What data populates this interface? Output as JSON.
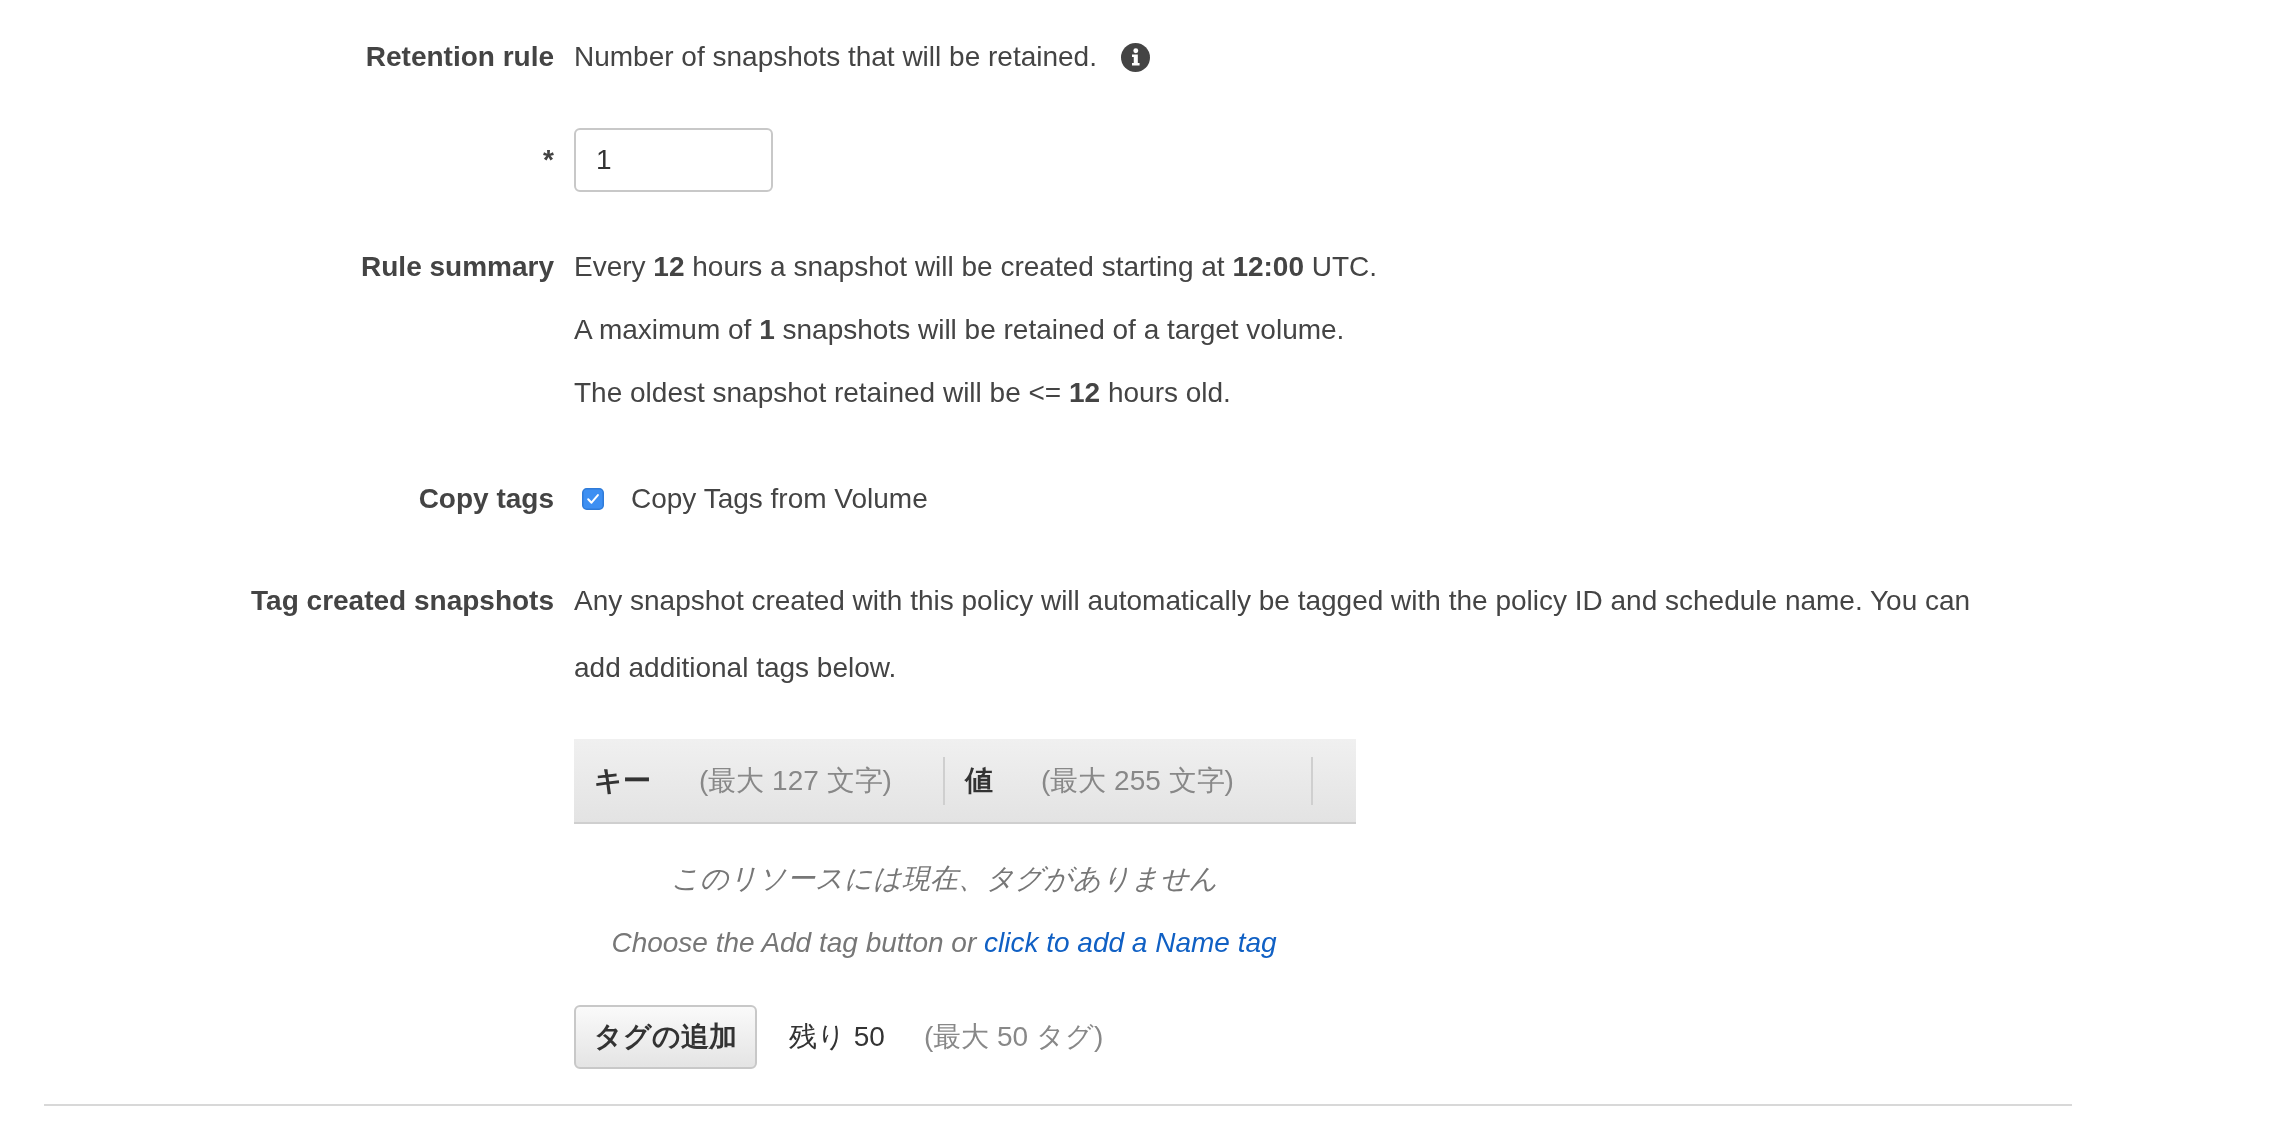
{
  "retention_rule": {
    "label": "Retention rule",
    "description": "Number of snapshots that will be retained.",
    "required_mark": "*",
    "value": "1"
  },
  "rule_summary": {
    "label": "Rule summary",
    "lines": [
      "Every **12** hours a snapshot will be created starting at **12:00** UTC.",
      "A maximum of **1** snapshots will be retained of a target volume.",
      "The oldest snapshot retained will be <= **12** hours old."
    ]
  },
  "copy_tags": {
    "label": "Copy tags",
    "option": "Copy Tags from Volume",
    "checked": true
  },
  "tag_created_snapshots": {
    "label": "Tag created snapshots",
    "description": "Any snapshot created with this policy will automatically be tagged with the policy ID and schedule name. You can add additional tags below."
  },
  "tag_table": {
    "columns": [
      {
        "name": "キー",
        "hint": "(最大 127 文字)"
      },
      {
        "name": "値",
        "hint": "(最大 255 文字)"
      }
    ],
    "empty_message": "このリソースには現在、タグがありません",
    "empty_hint": "Choose the Add tag button or",
    "empty_link": "click to add a Name tag"
  },
  "tag_footer": {
    "button": "タグの追加",
    "remaining": "残り 50",
    "limit": "(最大 50 タグ)"
  }
}
